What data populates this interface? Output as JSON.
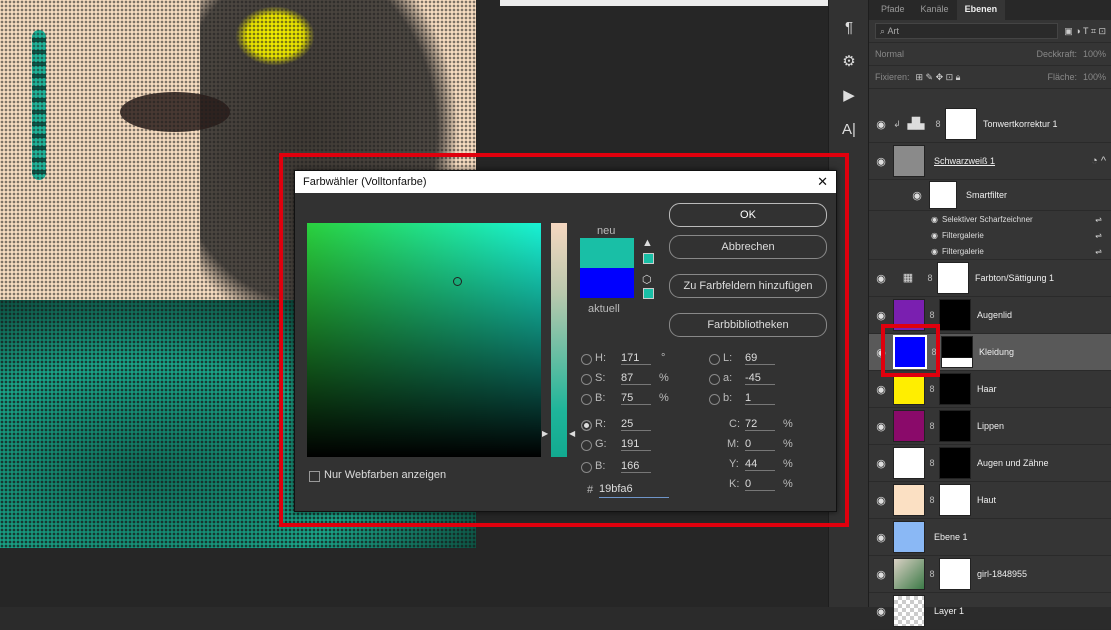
{
  "dialog": {
    "title": "Farbwähler (Volltonfarbe)",
    "close": "✕",
    "label_new": "neu",
    "label_current": "aktuell",
    "buttons": {
      "ok": "OK",
      "cancel": "Abbrechen",
      "add_swatch": "Zu Farbfeldern hinzufügen",
      "libraries": "Farbbibliotheken"
    },
    "hsb": {
      "h_label": "H:",
      "h_value": "171",
      "h_unit": "°",
      "s_label": "S:",
      "s_value": "87",
      "s_unit": "%",
      "b_label": "B:",
      "b_value": "75",
      "b_unit": "%"
    },
    "rgb": {
      "r_label": "R:",
      "r_value": "25",
      "g_label": "G:",
      "g_value": "191",
      "b_label": "B:",
      "b_value": "166"
    },
    "lab": {
      "l_label": "L:",
      "l_value": "69",
      "a_label": "a:",
      "a_value": "-45",
      "b_label": "b:",
      "b_value": "1"
    },
    "cmyk": {
      "c_label": "C:",
      "c_value": "72",
      "c_unit": "%",
      "m_label": "M:",
      "m_value": "0",
      "m_unit": "%",
      "y_label": "Y:",
      "y_value": "44",
      "y_unit": "%",
      "k_label": "K:",
      "k_value": "0",
      "k_unit": "%"
    },
    "hex_label": "#",
    "hex_value": "19bfa6",
    "web_only": "Nur Webfarben anzeigen",
    "colors": {
      "new": "#19bfa6",
      "current": "#0000ff"
    }
  },
  "tools": [
    "¶",
    "⚙",
    "▶",
    "A|"
  ],
  "panel": {
    "tabs": [
      "Pfade",
      "Kanäle",
      "Ebenen"
    ],
    "filter_placeholder": "Art",
    "blend_mode": "Normal",
    "opacity_label": "Deckkraft:",
    "opacity_value": "100%",
    "lock_label": "Fixieren:",
    "fill_label": "Fläche:",
    "fill_value": "100%",
    "layers": [
      {
        "name": "Tonwertkorrektur 1",
        "thumb": "#2a2a2a",
        "mask": "#ffffff"
      },
      {
        "name": "Schwarzweiß 1",
        "thumb": "#888888",
        "mask": ""
      },
      {
        "name": "Smartfilter",
        "thumb": "",
        "mask": "#ffffff"
      },
      {
        "name": "Farbton/Sättigung 1",
        "thumb": "#2a2a2a",
        "mask": "#ffffff"
      },
      {
        "name": "Augenlid",
        "thumb": "#7a1fb0",
        "mask": "#000000"
      },
      {
        "name": "Kleidung",
        "thumb": "#0000ff",
        "mask": "#000000"
      },
      {
        "name": "Haar",
        "thumb": "#ffee00",
        "mask": "#000000"
      },
      {
        "name": "Lippen",
        "thumb": "#8a0a6a",
        "mask": "#000000"
      },
      {
        "name": "Augen und Zähne",
        "thumb": "#ffffff",
        "mask": "#000000"
      },
      {
        "name": "Haut",
        "thumb": "#fbe0c3",
        "mask": "#ffffff"
      },
      {
        "name": "Ebene 1",
        "thumb": "#8ab8f5",
        "mask": ""
      },
      {
        "name": "girl-1848955",
        "thumb": "#6f8a66",
        "mask": "#ffffff"
      },
      {
        "name": "Layer 1",
        "thumb": "#dddddd",
        "mask": ""
      }
    ],
    "filters": [
      "Selektiver Scharfzeichner",
      "Filtergalerie",
      "Filtergalerie"
    ]
  }
}
